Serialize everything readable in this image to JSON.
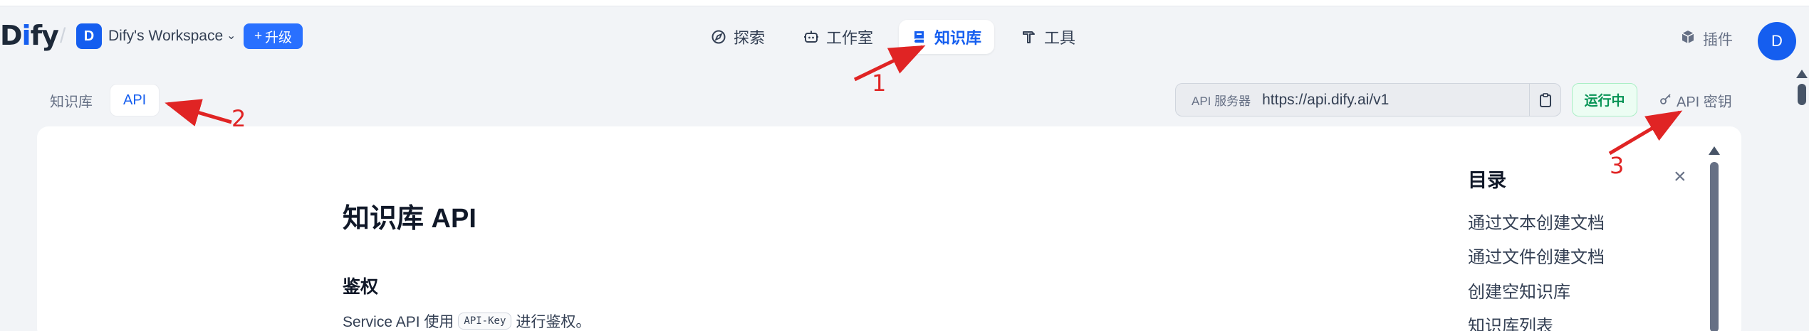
{
  "app": {
    "logo_prefix": "D",
    "logo_i": "i",
    "logo_suffix": "fy",
    "separator": "/"
  },
  "workspace": {
    "avatar_letter": "D",
    "name": "Dify's Workspace",
    "chevron": "⌄",
    "upgrade_icon": "+",
    "upgrade_label": "升级"
  },
  "nav": [
    {
      "label": "探索",
      "icon": "compass-icon"
    },
    {
      "label": "工作室",
      "icon": "robot-icon"
    },
    {
      "label": "知识库",
      "icon": "book-icon",
      "active": true
    },
    {
      "label": "工具",
      "icon": "hammer-icon"
    }
  ],
  "header_right": {
    "plugin_label": "插件",
    "user_avatar": "D"
  },
  "subtabs": [
    {
      "label": "知识库",
      "active": false
    },
    {
      "label": "API",
      "active": true
    }
  ],
  "api": {
    "server_label": "API 服务器",
    "url": "https://api.dify.ai/v1",
    "status": "运行中",
    "key_label": "API 密钥"
  },
  "doc": {
    "title": "知识库 API",
    "section": "鉴权",
    "text_before": "Service API 使用",
    "code": "API-Key",
    "text_after": "进行鉴权。"
  },
  "toc": {
    "title": "目录",
    "close_icon": "×",
    "items": [
      "通过文本创建文档",
      "通过文件创建文档",
      "创建空知识库",
      "知识库列表"
    ]
  },
  "annotations": [
    "1",
    "2",
    "3"
  ],
  "colors": {
    "accent": "#155eef",
    "annotation": "#e02424",
    "status_green": "#079455"
  }
}
